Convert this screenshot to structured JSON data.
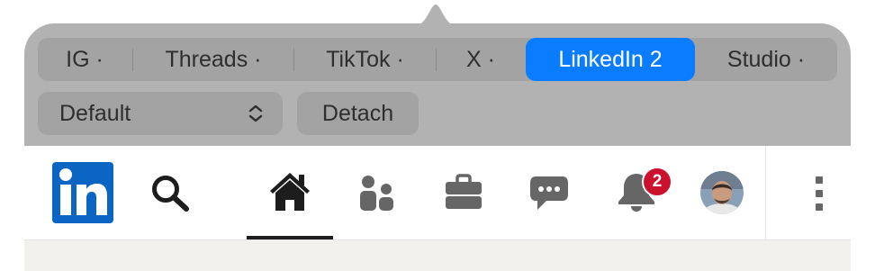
{
  "tabs": [
    {
      "label": "IG ·",
      "active": false
    },
    {
      "label": "Threads ·",
      "active": false
    },
    {
      "label": "TikTok ·",
      "active": false
    },
    {
      "label": "X ·",
      "active": false
    },
    {
      "label": "LinkedIn 2",
      "active": true
    },
    {
      "label": "Studio ·",
      "active": false
    }
  ],
  "profile_select": {
    "value": "Default"
  },
  "detach_button": {
    "label": "Detach"
  },
  "linkedin_nav": {
    "logo_icon": "linkedin-logo-icon",
    "items": [
      {
        "icon": "search-icon"
      },
      {
        "icon": "home-icon",
        "active": true
      },
      {
        "icon": "my-network-icon"
      },
      {
        "icon": "jobs-icon"
      },
      {
        "icon": "messaging-icon"
      },
      {
        "icon": "notifications-icon",
        "badge": "2"
      },
      {
        "icon": "avatar"
      },
      {
        "icon": "more-vertical-icon"
      }
    ]
  },
  "colors": {
    "accent": "#0a7cff",
    "linkedin_blue": "#0a66c2",
    "badge_red": "#cb112d",
    "popover_bg": "#b2b2b2"
  }
}
